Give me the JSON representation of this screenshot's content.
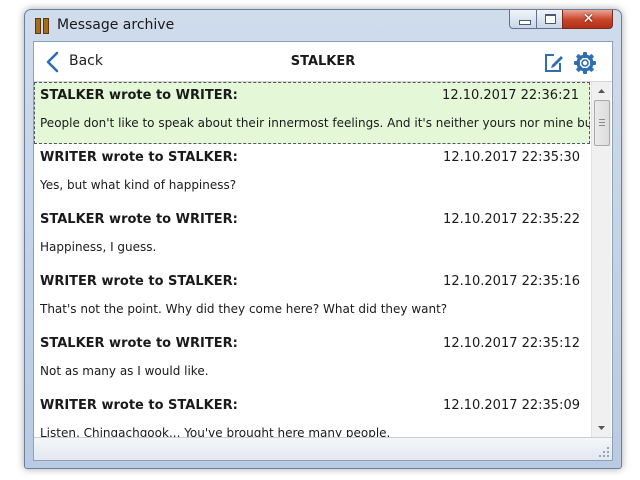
{
  "window": {
    "title": "Message archive"
  },
  "toolbar": {
    "back_label": "Back",
    "title": "STALKER"
  },
  "messages": [
    {
      "from": "STALKER wrote to WRITER:",
      "time": "12.10.2017 22:36:21",
      "text": "People don't like to speak about their innermost feelings. And it's neither yours nor mine business."
    },
    {
      "from": "WRITER wrote to STALKER:",
      "time": "12.10.2017 22:35:30",
      "text": "Yes, but what kind of happiness?"
    },
    {
      "from": "STALKER wrote to WRITER:",
      "time": "12.10.2017 22:35:22",
      "text": "Happiness, I guess."
    },
    {
      "from": "WRITER wrote to STALKER:",
      "time": "12.10.2017 22:35:16",
      "text": "That's not the point. Why did they come here? What did they want?"
    },
    {
      "from": "STALKER wrote to WRITER:",
      "time": "12.10.2017 22:35:12",
      "text": "Not as many as I would like."
    },
    {
      "from": "WRITER wrote to STALKER:",
      "time": "12.10.2017 22:35:09",
      "text": "Listen, Chingachgook... You've brought here many people."
    }
  ],
  "colors": {
    "selected_row": "#e4f8d8",
    "icon_blue": "#2f6fb0",
    "close_red": "#c8432a"
  },
  "icons": {
    "back": "chevron-left-icon",
    "edit": "edit-icon",
    "settings": "gear-icon"
  }
}
